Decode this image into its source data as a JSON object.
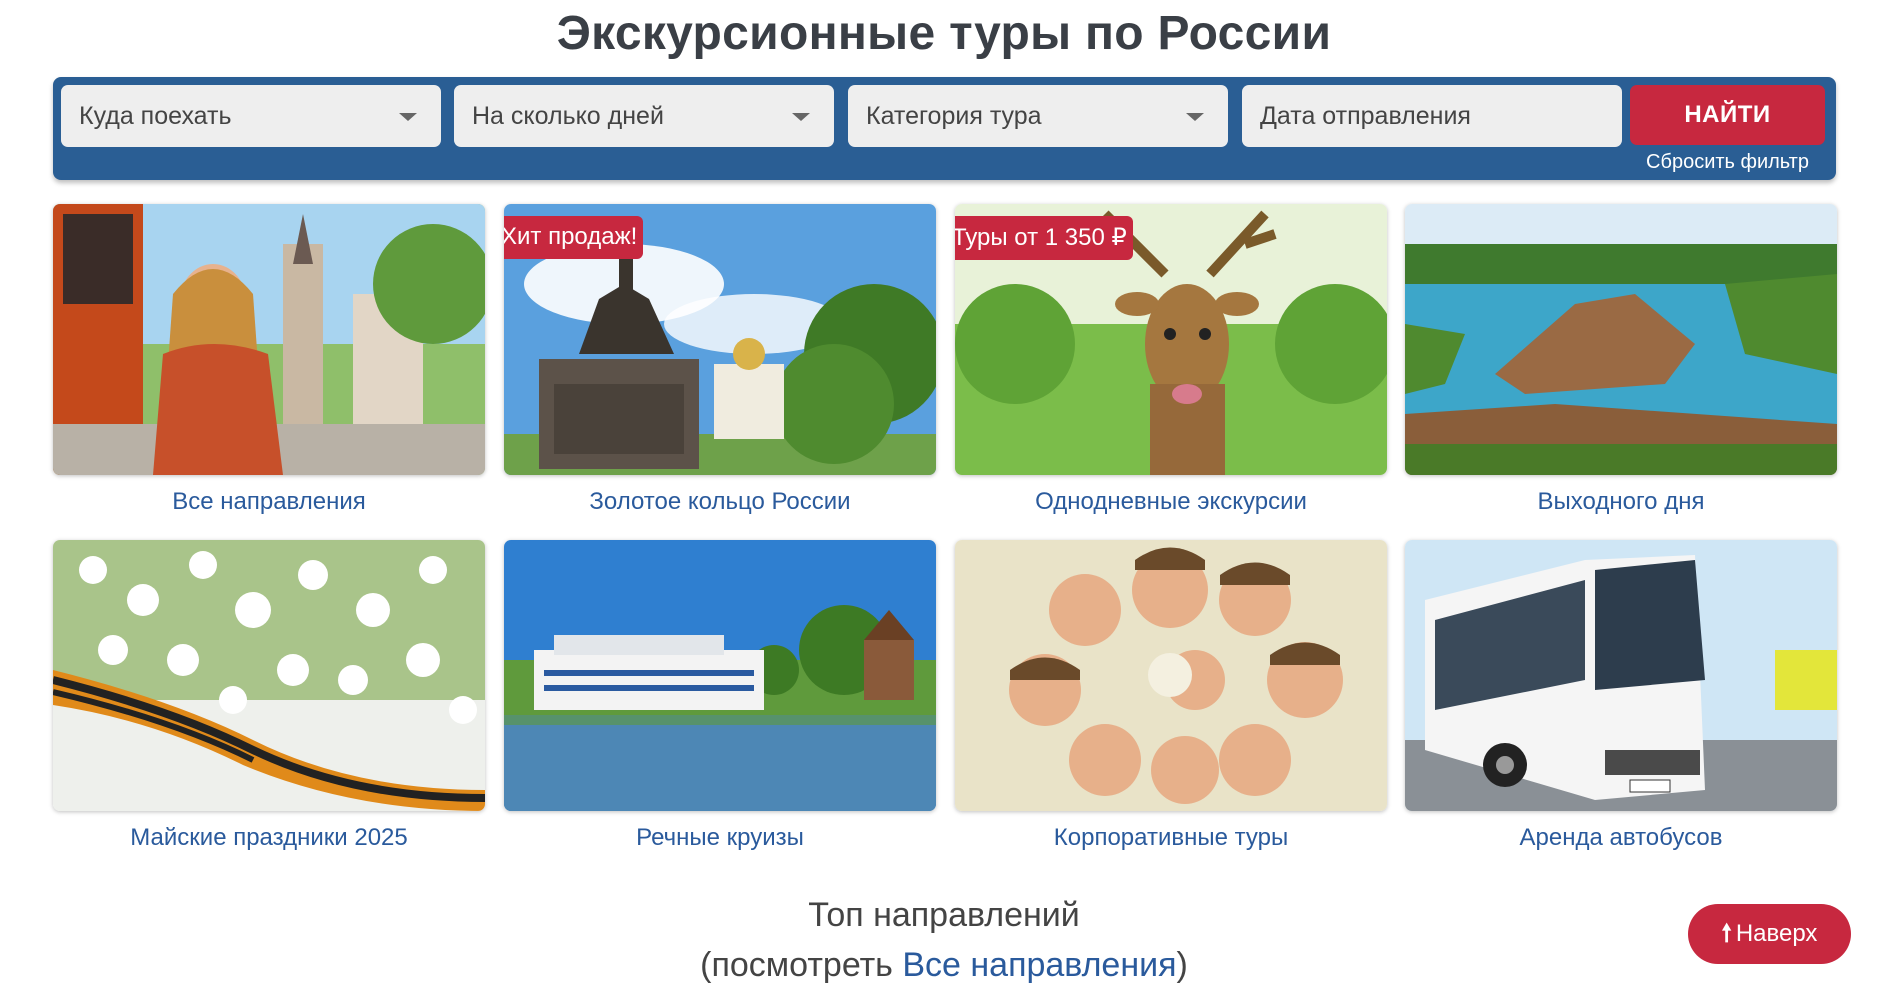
{
  "page": {
    "title": "Экскурсионные туры по России"
  },
  "filters": {
    "destination": "Куда поехать",
    "days": "На сколько дней",
    "category": "Категория тура",
    "date_placeholder": "Дата отправления",
    "find_button": "НАЙТИ",
    "reset_link": "Сбросить фильтр"
  },
  "cards": [
    {
      "caption": "Все направления",
      "badge": ""
    },
    {
      "caption": "Золотое кольцо России",
      "badge": "Хит продаж!"
    },
    {
      "caption": "Однодневные экскурсии",
      "badge": "Туры от 1 350 ₽"
    },
    {
      "caption": "Выходного дня",
      "badge": ""
    },
    {
      "caption": "Майские праздники 2025",
      "badge": ""
    },
    {
      "caption": "Речные круизы",
      "badge": ""
    },
    {
      "caption": "Корпоративные туры",
      "badge": ""
    },
    {
      "caption": "Аренда автобусов",
      "badge": ""
    }
  ],
  "top": {
    "title": "Топ направлений",
    "sub_prefix": "(посмотреть ",
    "sub_link": "Все направления",
    "sub_suffix": ")"
  },
  "up_button": {
    "arrow": "🠕",
    "label": "Наверх"
  },
  "colors": {
    "accent": "#c7283f",
    "bar": "#2a5e94",
    "link": "#2a5a9c"
  }
}
